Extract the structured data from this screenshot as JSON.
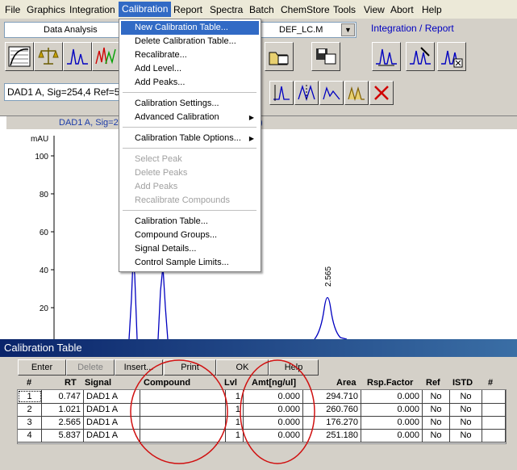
{
  "menubar": {
    "items": [
      "File",
      "Graphics",
      "Integration",
      "Calibration",
      "Report",
      "Spectra",
      "Batch",
      "ChemStore",
      "Tools",
      "View",
      "Abort",
      "Help"
    ],
    "active": "Calibration"
  },
  "toolbar": {
    "view_combo": "Data Analysis",
    "method_combo": "DEF_LC.M",
    "link_label": "Integration / Report",
    "signal_box": "DAD1 A, Sig=254,4 Ref=550"
  },
  "dropdown": {
    "items": [
      {
        "label": "New Calibration Table...",
        "state": "selected"
      },
      {
        "label": "Delete Calibration Table...",
        "state": "enabled"
      },
      {
        "label": "Recalibrate...",
        "state": "enabled"
      },
      {
        "label": "Add Level...",
        "state": "enabled"
      },
      {
        "label": "Add Peaks...",
        "state": "enabled"
      },
      {
        "label": "Calibration Settings...",
        "state": "enabled"
      },
      {
        "label": "Advanced Calibration",
        "state": "enabled",
        "submenu": true
      },
      {
        "label": "Calibration Table Options...",
        "state": "enabled",
        "submenu": true
      },
      {
        "label": "Select Peak",
        "state": "disabled"
      },
      {
        "label": "Delete Peaks",
        "state": "disabled"
      },
      {
        "label": "Add Peaks",
        "state": "disabled"
      },
      {
        "label": "Recalibrate Compounds",
        "state": "disabled"
      },
      {
        "label": "Calibration Table...",
        "state": "enabled"
      },
      {
        "label": "Compound Groups...",
        "state": "enabled"
      },
      {
        "label": "Signal Details...",
        "state": "enabled"
      },
      {
        "label": "Control Sample Limits...",
        "state": "enabled"
      }
    ]
  },
  "chart": {
    "title_left": "DAD1 A, Sig=25",
    "title_right": ")",
    "unit": "mAU",
    "peak_label": "2.565"
  },
  "chart_data": {
    "type": "line",
    "ylabel": "mAU",
    "yticks": [
      20,
      40,
      60,
      80,
      100
    ],
    "peaks": [
      {
        "rt": 0.747,
        "label": ""
      },
      {
        "rt": 1.021,
        "label": ""
      },
      {
        "rt": 2.565,
        "label": "2.565",
        "height": 25
      }
    ]
  },
  "calibration": {
    "title": "Calibration Table",
    "buttons": [
      {
        "label": "Enter",
        "enabled": true
      },
      {
        "label": "Delete",
        "enabled": false
      },
      {
        "label": "Insert...",
        "enabled": true
      },
      {
        "label": "Print",
        "enabled": true
      },
      {
        "label": "OK",
        "enabled": true
      },
      {
        "label": "Help",
        "enabled": true
      }
    ],
    "columns": [
      "#",
      "RT",
      "Signal",
      "Compound",
      "Lvl",
      "Amt[ng/ul]",
      "Area",
      "Rsp.Factor",
      "Ref",
      "ISTD",
      "#"
    ],
    "rows": [
      {
        "n": "1",
        "rt": "0.747",
        "signal": "DAD1 A",
        "compound": "",
        "lvl": "1",
        "amt": "0.000",
        "area": "294.710",
        "rsp": "0.000",
        "ref": "No",
        "istd": "No"
      },
      {
        "n": "2",
        "rt": "1.021",
        "signal": "DAD1 A",
        "compound": "",
        "lvl": "1",
        "amt": "0.000",
        "area": "260.760",
        "rsp": "0.000",
        "ref": "No",
        "istd": "No"
      },
      {
        "n": "3",
        "rt": "2.565",
        "signal": "DAD1 A",
        "compound": "",
        "lvl": "1",
        "amt": "0.000",
        "area": "176.270",
        "rsp": "0.000",
        "ref": "No",
        "istd": "No"
      },
      {
        "n": "4",
        "rt": "5.837",
        "signal": "DAD1 A",
        "compound": "",
        "lvl": "1",
        "amt": "0.000",
        "area": "251.180",
        "rsp": "0.000",
        "ref": "No",
        "istd": "No"
      }
    ]
  },
  "annotation_color": "#d01010"
}
